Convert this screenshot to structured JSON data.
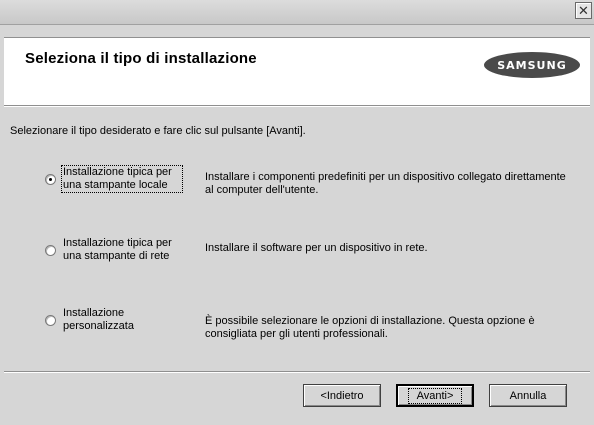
{
  "titlebar": {
    "close_glyph": "✕"
  },
  "header": {
    "title": "Seleziona il tipo di installazione",
    "logo_text": "SAMSUNG"
  },
  "prompt": "Selezionare il tipo desiderato e fare clic sul pulsante [Avanti].",
  "options": [
    {
      "label_line1": "Installazione tipica per",
      "label_line2": "una stampante locale",
      "description_line1": "Installare i componenti predefiniti per un dispositivo collegato direttamente",
      "description_line2": "al computer dell'utente.",
      "selected": true
    },
    {
      "label_line1": "Installazione tipica per",
      "label_line2": "una stampante di rete",
      "description_line1": "Installare il software per un dispositivo in rete.",
      "description_line2": "",
      "selected": false
    },
    {
      "label_line1": "Installazione",
      "label_line2": "personalizzata",
      "description_line1": "È possibile selezionare le opzioni di installazione. Questa opzione è",
      "description_line2": "consigliata per gli utenti professionali.",
      "selected": false
    }
  ],
  "buttons": {
    "back": "<Indietro",
    "next": "Avanti>",
    "cancel": "Annulla"
  }
}
